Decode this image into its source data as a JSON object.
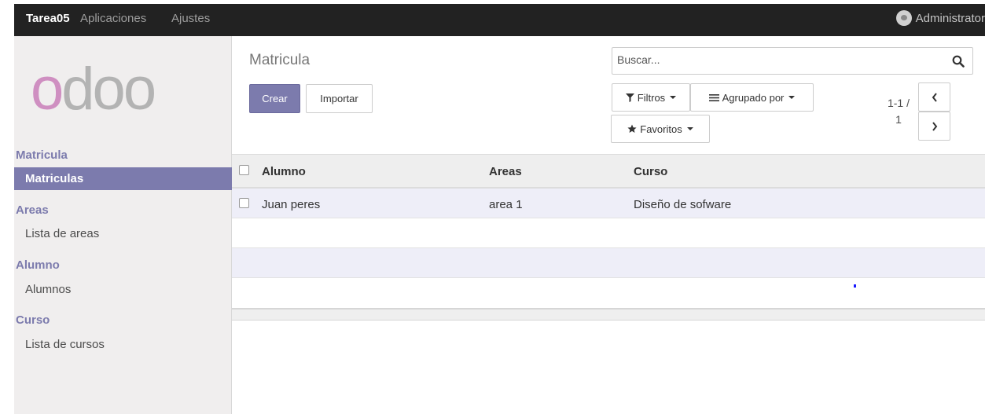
{
  "topbar": {
    "brand": "Tarea05",
    "apps": "Aplicaciones",
    "settings": "Ajustes",
    "user": "Administrator"
  },
  "sidebar": {
    "logo": {
      "first": "o",
      "rest": "doo"
    },
    "sections": [
      {
        "title": "Matricula",
        "items": [
          "Matriculas"
        ]
      },
      {
        "title": "Areas",
        "items": [
          "Lista de areas"
        ]
      },
      {
        "title": "Alumno",
        "items": [
          "Alumnos"
        ]
      },
      {
        "title": "Curso",
        "items": [
          "Lista de cursos"
        ]
      }
    ]
  },
  "control": {
    "breadcrumb": "Matricula",
    "create": "Crear",
    "import": "Importar",
    "search_placeholder": "Buscar...",
    "filters": "Filtros",
    "group_by": "Agrupado por",
    "favorites": "Favoritos",
    "pager": {
      "range": "1-1 /",
      "total": "1"
    }
  },
  "table": {
    "columns": [
      "Alumno",
      "Areas",
      "Curso"
    ],
    "rows": [
      {
        "alumno": "Juan peres",
        "areas": "area 1",
        "curso": "Diseño de sofware"
      }
    ]
  },
  "colors": {
    "accent": "#7c7bad",
    "topbar": "#222222",
    "logo_pink": "#cf8fc1",
    "logo_gray": "#b3b3b3"
  }
}
